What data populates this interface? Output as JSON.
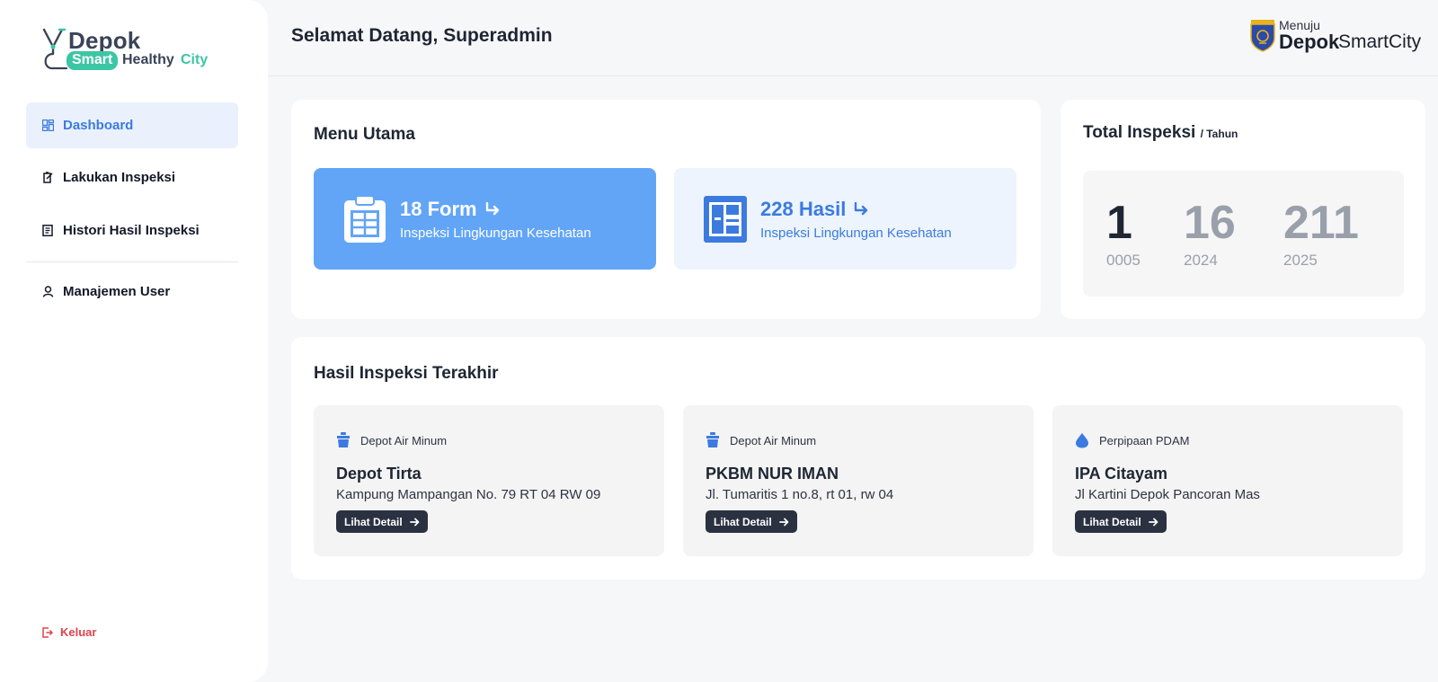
{
  "logo": {
    "depok": "Depok",
    "smart": "Smart",
    "healthy": "Healthy",
    "city": "City"
  },
  "sidebar": {
    "items": [
      {
        "label": "Dashboard",
        "icon": "dashboard-icon",
        "active": true
      },
      {
        "label": "Lakukan Inspeksi",
        "icon": "clipboard-edit-icon",
        "active": false
      },
      {
        "label": "Histori Hasil Inspeksi",
        "icon": "document-icon",
        "active": false
      },
      {
        "label": "Manajemen User",
        "icon": "user-icon",
        "active": false
      }
    ],
    "logout": "Keluar"
  },
  "header": {
    "greeting": "Selamat Datang, Superadmin",
    "brand_menuju": "Menuju",
    "brand_depok": "Depok",
    "brand_smartcity": "SmartCity"
  },
  "menu_utama": {
    "title": "Menu Utama",
    "tiles": [
      {
        "count": "18 Form",
        "subtitle": "Inspeksi Lingkungan Kesehatan",
        "icon": "clipboard-icon"
      },
      {
        "count": "228 Hasil",
        "subtitle": "Inspeksi Lingkungan Kesehatan",
        "icon": "newspaper-icon"
      }
    ]
  },
  "total_inspeksi": {
    "title": "Total Inspeksi",
    "unit": "/ Tahun",
    "stats": [
      {
        "value": "1",
        "year": "0005"
      },
      {
        "value": "16",
        "year": "2024"
      },
      {
        "value": "211",
        "year": "2025"
      }
    ]
  },
  "recent": {
    "title": "Hasil Inspeksi Terakhir",
    "button_label": "Lihat Detail",
    "items": [
      {
        "category": "Depot Air Minum",
        "name": "Depot Tirta",
        "address": "Kampung Mampangan No. 79 RT 04 RW 09",
        "icon": "water-gallon-icon"
      },
      {
        "category": "Depot Air Minum",
        "name": "PKBM NUR IMAN",
        "address": "Jl. Tumaritis 1 no.8, rt 01, rw 04",
        "icon": "water-gallon-icon"
      },
      {
        "category": "Perpipaan PDAM",
        "name": "IPA Citayam",
        "address": "Jl Kartini Depok Pancoran Mas",
        "icon": "water-drop-icon"
      }
    ]
  },
  "colors": {
    "accent": "#3b7be0",
    "tile_blue": "#62a5f7",
    "tile_light": "#edf4fe",
    "brand_green": "#3cc6a4",
    "danger": "#e2434b",
    "button_dark": "#2a3140"
  }
}
